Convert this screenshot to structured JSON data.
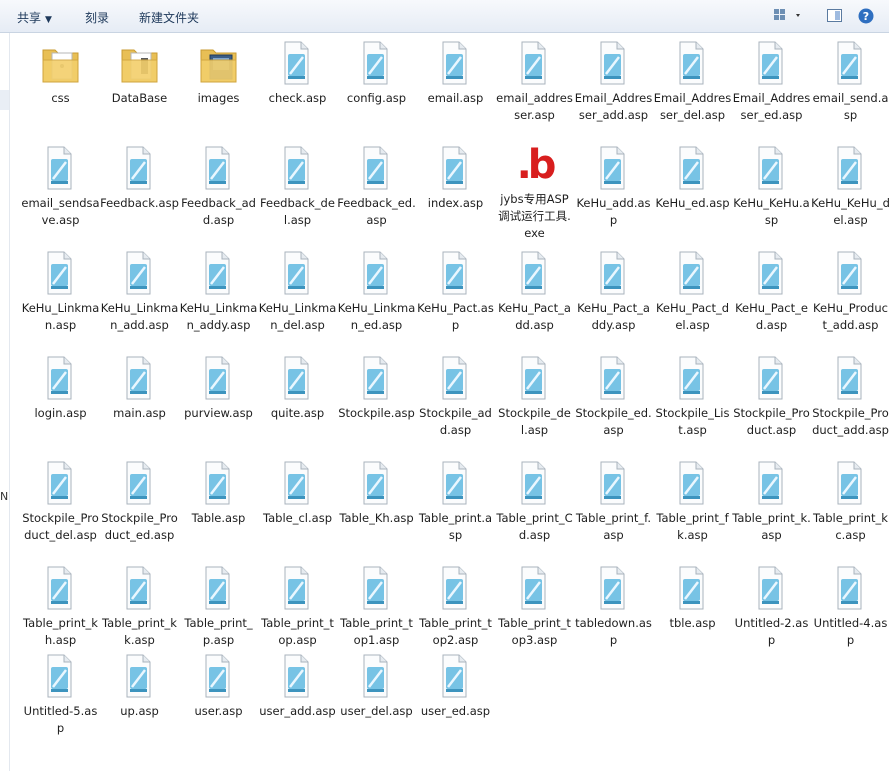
{
  "toolbar": {
    "share_label": "共享",
    "burn_label": "刻录",
    "new_folder_label": "新建文件夹"
  },
  "colors": {
    "exe_logo": "#d81e1e",
    "folder": "#f3cf6b",
    "asp_file_accent": "#5fb9e0"
  },
  "files": [
    {
      "name": "css",
      "type": "folder-text"
    },
    {
      "name": "DataBase",
      "type": "folder-doc"
    },
    {
      "name": "images",
      "type": "folder-img"
    },
    {
      "name": "check.asp",
      "type": "asp"
    },
    {
      "name": "config.asp",
      "type": "asp"
    },
    {
      "name": "email.asp",
      "type": "asp"
    },
    {
      "name": "email_addresser.asp",
      "type": "asp"
    },
    {
      "name": "Email_Addresser_add.asp",
      "type": "asp"
    },
    {
      "name": "Email_Addresser_del.asp",
      "type": "asp"
    },
    {
      "name": "Email_Addresser_ed.asp",
      "type": "asp"
    },
    {
      "name": "email_send.asp",
      "type": "asp"
    },
    {
      "name": "email_sendsave.asp",
      "type": "asp"
    },
    {
      "name": "Feedback.asp",
      "type": "asp"
    },
    {
      "name": "Feedback_add.asp",
      "type": "asp"
    },
    {
      "name": "Feedback_del.asp",
      "type": "asp"
    },
    {
      "name": "Feedback_ed.asp",
      "type": "asp"
    },
    {
      "name": "index.asp",
      "type": "asp"
    },
    {
      "name": "jybs专用ASP调试运行工具.exe",
      "type": "exe",
      "logo": ".b"
    },
    {
      "name": "KeHu_add.asp",
      "type": "asp"
    },
    {
      "name": "KeHu_ed.asp",
      "type": "asp"
    },
    {
      "name": "KeHu_KeHu.asp",
      "type": "asp"
    },
    {
      "name": "KeHu_KeHu_del.asp",
      "type": "asp"
    },
    {
      "name": "KeHu_Linkman.asp",
      "type": "asp"
    },
    {
      "name": "KeHu_Linkman_add.asp",
      "type": "asp"
    },
    {
      "name": "KeHu_Linkman_addy.asp",
      "type": "asp"
    },
    {
      "name": "KeHu_Linkman_del.asp",
      "type": "asp"
    },
    {
      "name": "KeHu_Linkman_ed.asp",
      "type": "asp"
    },
    {
      "name": "KeHu_Pact.asp",
      "type": "asp"
    },
    {
      "name": "KeHu_Pact_add.asp",
      "type": "asp"
    },
    {
      "name": "KeHu_Pact_addy.asp",
      "type": "asp"
    },
    {
      "name": "KeHu_Pact_del.asp",
      "type": "asp"
    },
    {
      "name": "KeHu_Pact_ed.asp",
      "type": "asp"
    },
    {
      "name": "KeHu_Product_add.asp",
      "type": "asp"
    },
    {
      "name": "login.asp",
      "type": "asp"
    },
    {
      "name": "main.asp",
      "type": "asp"
    },
    {
      "name": "purview.asp",
      "type": "asp"
    },
    {
      "name": "quite.asp",
      "type": "asp"
    },
    {
      "name": "Stockpile.asp",
      "type": "asp"
    },
    {
      "name": "Stockpile_add.asp",
      "type": "asp"
    },
    {
      "name": "Stockpile_del.asp",
      "type": "asp"
    },
    {
      "name": "Stockpile_ed.asp",
      "type": "asp"
    },
    {
      "name": "Stockpile_List.asp",
      "type": "asp"
    },
    {
      "name": "Stockpile_Product.asp",
      "type": "asp"
    },
    {
      "name": "Stockpile_Product_add.asp",
      "type": "asp"
    },
    {
      "name": "Stockpile_Product_del.asp",
      "type": "asp"
    },
    {
      "name": "Stockpile_Product_ed.asp",
      "type": "asp"
    },
    {
      "name": "Table.asp",
      "type": "asp"
    },
    {
      "name": "Table_cl.asp",
      "type": "asp"
    },
    {
      "name": "Table_Kh.asp",
      "type": "asp"
    },
    {
      "name": "Table_print.asp",
      "type": "asp"
    },
    {
      "name": "Table_print_Cd.asp",
      "type": "asp"
    },
    {
      "name": "Table_print_f.asp",
      "type": "asp"
    },
    {
      "name": "Table_print_fk.asp",
      "type": "asp"
    },
    {
      "name": "Table_print_k.asp",
      "type": "asp"
    },
    {
      "name": "Table_print_kc.asp",
      "type": "asp"
    },
    {
      "name": "Table_print_kh.asp",
      "type": "asp"
    },
    {
      "name": "Table_print_kk.asp",
      "type": "asp"
    },
    {
      "name": "Table_print_p.asp",
      "type": "asp"
    },
    {
      "name": "Table_print_top.asp",
      "type": "asp"
    },
    {
      "name": "Table_print_top1.asp",
      "type": "asp"
    },
    {
      "name": "Table_print_top2.asp",
      "type": "asp"
    },
    {
      "name": "Table_print_top3.asp",
      "type": "asp"
    },
    {
      "name": "tabledown.asp",
      "type": "asp"
    },
    {
      "name": "tble.asp",
      "type": "asp"
    },
    {
      "name": "Untitled-2.asp",
      "type": "asp"
    },
    {
      "name": "Untitled-4.asp",
      "type": "asp"
    },
    {
      "name": "Untitled-5.asp",
      "type": "asp"
    },
    {
      "name": "up.asp",
      "type": "asp"
    },
    {
      "name": "user.asp",
      "type": "asp"
    },
    {
      "name": "user_add.asp",
      "type": "asp"
    },
    {
      "name": "user_del.asp",
      "type": "asp"
    },
    {
      "name": "user_ed.asp",
      "type": "asp"
    }
  ]
}
